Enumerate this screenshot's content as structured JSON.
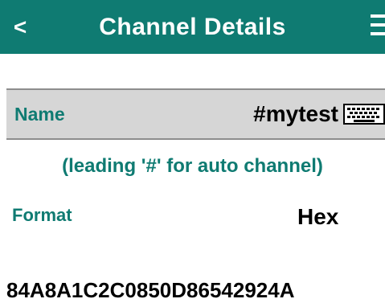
{
  "header": {
    "back_label": "<",
    "title": "Channel Details",
    "menu_icon": "hamburger-menu-icon",
    "background_color": "#0f7b72"
  },
  "name_field": {
    "label": "Name",
    "value": "#mytest",
    "icon": "keyboard-icon"
  },
  "hint": "(leading '#' for auto channel)",
  "format": {
    "label": "Format",
    "value": "Hex"
  },
  "data_value": "84A8A1C2C0850D86542924A",
  "colors": {
    "accent": "#0f7b72",
    "row_background": "#d6d6d6"
  }
}
